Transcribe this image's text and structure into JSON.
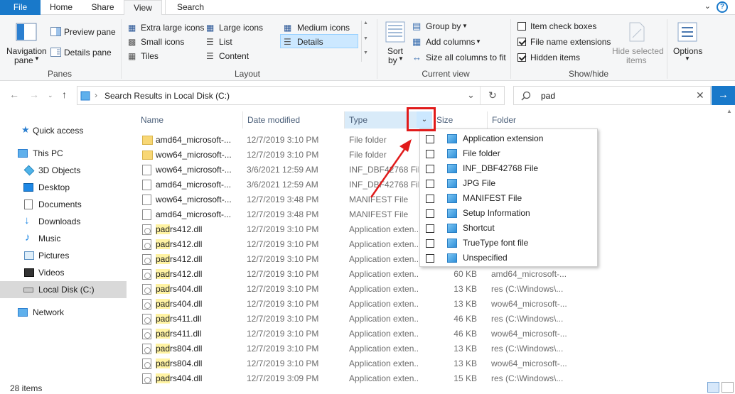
{
  "tabs": {
    "file": "File",
    "home": "Home",
    "share": "Share",
    "view": "View",
    "search": "Search"
  },
  "ribbon": {
    "panes": {
      "group_label": "Panes",
      "navigation_pane_1": "Navigation",
      "navigation_pane_2": "pane",
      "preview_pane": "Preview pane",
      "details_pane": "Details pane"
    },
    "layout": {
      "group_label": "Layout",
      "extra_large_icons": "Extra large icons",
      "large_icons": "Large icons",
      "medium_icons": "Medium icons",
      "small_icons": "Small icons",
      "list": "List",
      "details": "Details",
      "tiles": "Tiles",
      "content": "Content"
    },
    "current_view": {
      "group_label": "Current view",
      "sort_by_1": "Sort",
      "sort_by_2": "by",
      "group_by": "Group by",
      "add_columns": "Add columns",
      "size_all_columns": "Size all columns to fit"
    },
    "show_hide": {
      "group_label": "Show/hide",
      "item_check_boxes": "Item check boxes",
      "file_name_extensions": "File name extensions",
      "hidden_items": "Hidden items",
      "hide_selected_1": "Hide selected",
      "hide_selected_2": "items",
      "options": "Options"
    }
  },
  "address": {
    "path": "Search Results in Local Disk (C:)",
    "search_value": "pad"
  },
  "nav_pane": {
    "quick_access": "Quick access",
    "this_pc": "This PC",
    "objects3d": "3D Objects",
    "desktop": "Desktop",
    "documents": "Documents",
    "downloads": "Downloads",
    "music": "Music",
    "pictures": "Pictures",
    "videos": "Videos",
    "local_disk": "Local Disk (C:)",
    "network": "Network"
  },
  "columns": {
    "name": "Name",
    "date": "Date modified",
    "type": "Type",
    "size": "Size",
    "folder": "Folder"
  },
  "rows": [
    {
      "pre": "",
      "hl": "",
      "post": "amd64_microsoft-...",
      "date": "12/7/2019 3:10 PM",
      "type": "File folder",
      "size": "",
      "folder": ""
    },
    {
      "pre": "",
      "hl": "",
      "post": "wow64_microsoft-...",
      "date": "12/7/2019 3:10 PM",
      "type": "File folder",
      "size": "",
      "folder": ""
    },
    {
      "pre": "",
      "hl": "",
      "post": "wow64_microsoft-...",
      "date": "3/6/2021 12:59 AM",
      "type": "INF_DBF42768 File",
      "size": "",
      "folder": ""
    },
    {
      "pre": "",
      "hl": "",
      "post": "amd64_microsoft-...",
      "date": "3/6/2021 12:59 AM",
      "type": "INF_DBF42768 File",
      "size": "",
      "folder": ""
    },
    {
      "pre": "",
      "hl": "",
      "post": "wow64_microsoft-...",
      "date": "12/7/2019 3:48 PM",
      "type": "MANIFEST File",
      "size": "",
      "folder": ""
    },
    {
      "pre": "",
      "hl": "",
      "post": "amd64_microsoft-...",
      "date": "12/7/2019 3:48 PM",
      "type": "MANIFEST File",
      "size": "",
      "folder": ""
    },
    {
      "pre": "",
      "hl": "pad",
      "post": "rs412.dll",
      "date": "12/7/2019 3:10 PM",
      "type": "Application exten...",
      "size": "",
      "folder": ""
    },
    {
      "pre": "",
      "hl": "pad",
      "post": "rs412.dll",
      "date": "12/7/2019 3:10 PM",
      "type": "Application exten...",
      "size": "",
      "folder": ""
    },
    {
      "pre": "",
      "hl": "pad",
      "post": "rs412.dll",
      "date": "12/7/2019 3:10 PM",
      "type": "Application exten...",
      "size": "",
      "folder": ""
    },
    {
      "pre": "",
      "hl": "pad",
      "post": "rs412.dll",
      "date": "12/7/2019 3:10 PM",
      "type": "Application exten...",
      "size": "60 KB",
      "folder": "amd64_microsoft-..."
    },
    {
      "pre": "",
      "hl": "pad",
      "post": "rs404.dll",
      "date": "12/7/2019 3:10 PM",
      "type": "Application exten...",
      "size": "13 KB",
      "folder": "res (C:\\Windows\\..."
    },
    {
      "pre": "",
      "hl": "pad",
      "post": "rs404.dll",
      "date": "12/7/2019 3:10 PM",
      "type": "Application exten...",
      "size": "13 KB",
      "folder": "wow64_microsoft-..."
    },
    {
      "pre": "",
      "hl": "pad",
      "post": "rs411.dll",
      "date": "12/7/2019 3:10 PM",
      "type": "Application exten...",
      "size": "46 KB",
      "folder": "res (C:\\Windows\\..."
    },
    {
      "pre": "",
      "hl": "pad",
      "post": "rs411.dll",
      "date": "12/7/2019 3:10 PM",
      "type": "Application exten...",
      "size": "46 KB",
      "folder": "wow64_microsoft-..."
    },
    {
      "pre": "",
      "hl": "pad",
      "post": "rs804.dll",
      "date": "12/7/2019 3:10 PM",
      "type": "Application exten...",
      "size": "13 KB",
      "folder": "res (C:\\Windows\\..."
    },
    {
      "pre": "",
      "hl": "pad",
      "post": "rs804.dll",
      "date": "12/7/2019 3:10 PM",
      "type": "Application exten...",
      "size": "13 KB",
      "folder": "wow64_microsoft-..."
    },
    {
      "pre": "",
      "hl": "pad",
      "post": "rs404.dll",
      "date": "12/7/2019 3:09 PM",
      "type": "Application exten...",
      "size": "15 KB",
      "folder": "res (C:\\Windows\\..."
    }
  ],
  "filter_options": [
    "Application extension",
    "File folder",
    "INF_DBF42768 File",
    "JPG File",
    "MANIFEST File",
    "Setup Information",
    "Shortcut",
    "TrueType font file",
    "Unspecified"
  ],
  "status": {
    "count": "28 items"
  },
  "colors": {
    "accent": "#1979ca",
    "selection": "#cce8ff",
    "highlight": "#fff3a3",
    "annotation_red": "#e11b1b"
  }
}
